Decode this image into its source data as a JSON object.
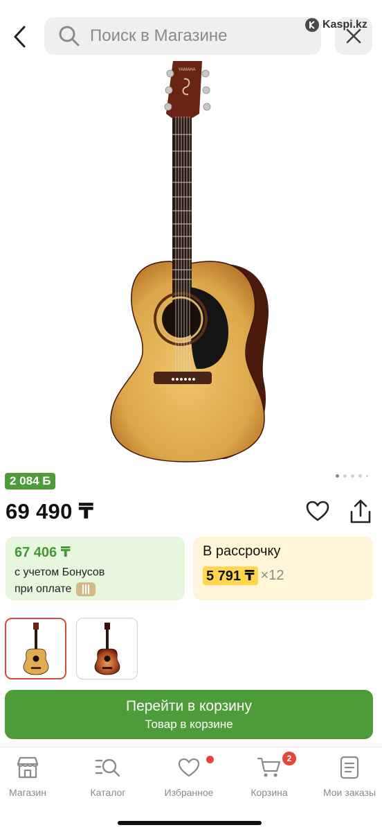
{
  "header": {
    "search_placeholder": "Поиск в Магазине",
    "watermark": "Kaspi.kz"
  },
  "product": {
    "image_alt": "Акустическая гитара YAMAHA",
    "headstock_text": "YAMAHA",
    "bonus_badge": "2 084 Б",
    "gallery_count": 5,
    "gallery_active_index": 0,
    "price": "69 490 ₸"
  },
  "bonus_card": {
    "amount": "67 406 ₸",
    "line1": "с учетом Бонусов",
    "line2": "при оплате"
  },
  "installment_card": {
    "title": "В рассрочку",
    "monthly": "5 791 ₸",
    "multiplier": "×12"
  },
  "thumbnails": [
    {
      "name": "natural",
      "selected": true
    },
    {
      "name": "sunburst",
      "selected": false
    }
  ],
  "cta": {
    "main": "Перейти в корзину",
    "sub": "Товар в корзине"
  },
  "tabbar": {
    "items": [
      {
        "label": "Магазин",
        "icon": "shop-icon"
      },
      {
        "label": "Каталог",
        "icon": "catalog-icon"
      },
      {
        "label": "Избранное",
        "icon": "heart-icon",
        "dot": true
      },
      {
        "label": "Корзина",
        "icon": "cart-icon",
        "count": "2"
      },
      {
        "label": "Мои заказы",
        "icon": "orders-icon"
      }
    ]
  },
  "colors": {
    "green": "#4e9b3a",
    "red": "#e2473a",
    "yellow": "#ffd64d"
  }
}
